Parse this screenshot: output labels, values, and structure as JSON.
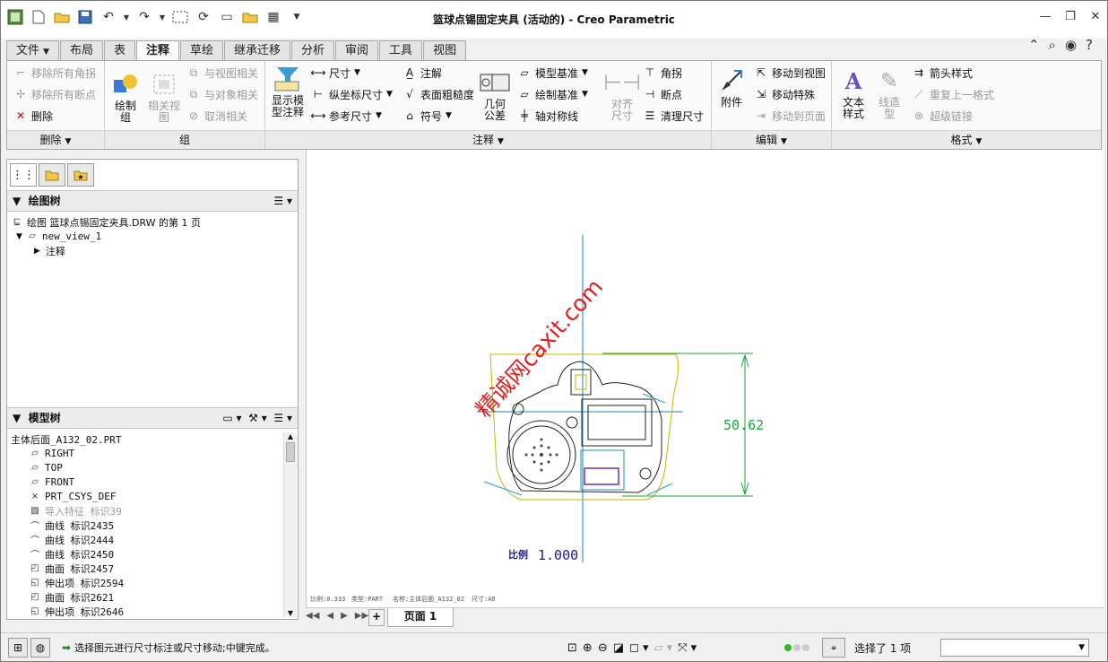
{
  "window": {
    "title": "篮球点锡固定夹具 (活动的) - Creo Parametric"
  },
  "tabs": [
    "文件",
    "布局",
    "表",
    "注释",
    "草绘",
    "继承迁移",
    "分析",
    "审阅",
    "工具",
    "视图"
  ],
  "ribbon": {
    "delete": {
      "remove_all_angles": "移除所有角拐",
      "remove_all_breaks": "移除所有断点",
      "delete": "删除",
      "footer": "删除"
    },
    "group": {
      "draw_group": "绘制\n组",
      "related_view": "相关视\n图",
      "view_related": "与视图相关",
      "object_related": "与对象相关",
      "cancel_related": "取消相关",
      "footer": "组"
    },
    "annotate": {
      "show_model_annotations": "显示模\n型注释",
      "dimension": "尺寸",
      "ordinate_dimension": "纵坐标尺寸",
      "reference_dimension": "参考尺寸",
      "note": "注解",
      "surface_finish": "表面粗糙度",
      "symbol": "符号",
      "gtol": "几何\n公差",
      "model_datum": "模型基准",
      "draw_datum": "绘制基准",
      "axis_symmetry": "轴对称线",
      "align_dimension": "对齐\n尺寸",
      "jog": "角拐",
      "break": "断点",
      "cleanup_dimension": "清理尺寸",
      "footer": "注释"
    },
    "edit": {
      "attach": "附件",
      "move_to_view": "移动到视图",
      "move_special": "移动特殊",
      "move_to_page": "移动到页面",
      "footer": "编辑"
    },
    "format": {
      "text_style": "文本\n样式",
      "line_style": "线造\n型",
      "arrow_style": "箭头样式",
      "repeat_last_format": "重复上一格式",
      "hyperlink": "超级链接",
      "footer": "格式"
    }
  },
  "drawing_tree": {
    "header": "绘图树",
    "page_item": "绘图 篮球点锡固定夹具.DRW 的第 1 页",
    "view": "new_view_1",
    "annotation": "注释"
  },
  "model_tree": {
    "header": "模型树",
    "items": [
      "主体后面_A132_02.PRT",
      "RIGHT",
      "TOP",
      "FRONT",
      "PRT_CSYS_DEF",
      "导入特征 标识39",
      "曲线 标识2435",
      "曲线 标识2444",
      "曲线 标识2450",
      "曲面 标识2457",
      "伸出项 标识2594",
      "曲面 标识2621",
      "伸出项 标识2646"
    ]
  },
  "canvas": {
    "dimension_value": "50.62",
    "scale_label": "比例",
    "scale_value": "1.000",
    "watermark": "精诚网caxit.com",
    "footer": {
      "scale": "比例:0.333",
      "type": "类型:PART",
      "name": "名称:主体后面_A132_02",
      "size": "尺寸:A0"
    }
  },
  "pagebar": {
    "page_tab": "页面 1",
    "add": "+"
  },
  "status": {
    "message": "选择图元进行尺寸标注或尺寸移动;中键完成。",
    "selected": "选择了 1 项"
  }
}
